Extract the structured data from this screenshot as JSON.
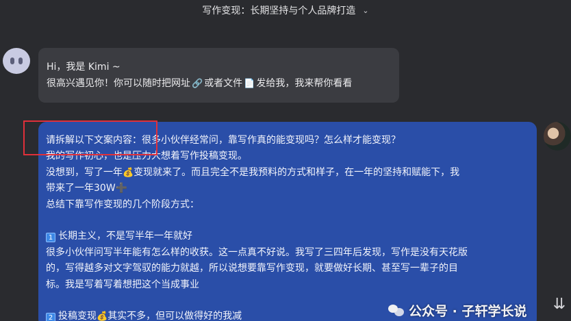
{
  "header": {
    "title": "写作变现：长期坚持与个人品牌打造",
    "dropdown_icon": "chevron-down-icon"
  },
  "bot_message": {
    "line1": "Hi，我是 Kimi ~",
    "line2_part1": "很高兴遇见你！你可以随时把网址",
    "link_emoji": "🔗",
    "line2_part2": "或者文件",
    "file_emoji": "📄",
    "line2_part3": "发给我，我来帮你看看"
  },
  "user_message": {
    "l1": "请拆解以下文案内容：很多小伙伴经常问，靠写作真的能变现吗？怎么样才能变现？",
    "l2": "我的写作初心，也是压力大想着写作投稿变现。",
    "l3a": "没想到，写了一年",
    "money_emoji": "💰",
    "l3b": "变现就来了。而且完全不是我预料的方式和样子，在一年的坚持和赋能下，我",
    "l4": "带来了一年30W➕",
    "l5": "总结下靠写作变现的几个阶段方式：",
    "badge1": "1",
    "l7": "长期主义，不是写半年一年就好",
    "l8": "很多小伙伴问写半年能有怎么样的收获。这一点真不好说。我写了三四年后发现，写作是没有天花版",
    "l9": "的，写得越多对文字驾驭的能力就越，所以说想要靠写作变现，就要做好长期、甚至写一辈子的目",
    "l10": "标。我是写着写着想把这个当成事业",
    "badge2": "2",
    "l12a": "投稿变现",
    "l12b": "其实不多，但可以做得好的我减"
  },
  "watermark": {
    "text": "公众号 · 子轩学长说"
  },
  "colors": {
    "background": "#2a2b2f",
    "bot_bubble": "#3b3c41",
    "user_bubble": "#2a4ea8",
    "highlight": "#e0303a"
  }
}
